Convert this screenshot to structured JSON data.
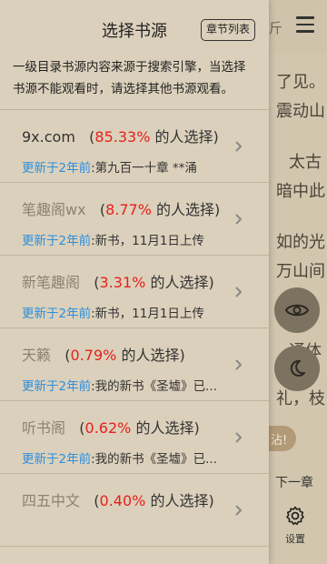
{
  "reader": {
    "top_fragment": "斤",
    "lines": [
      "了见。",
      "震动山",
      "太古",
      "暗中此",
      "如的光",
      "万山间",
      "兰",
      "通体",
      "礼，枝"
    ],
    "pill_text": "沾!",
    "next_chapter": "下一章",
    "settings_label": "设置"
  },
  "panel": {
    "title": "选择书源",
    "chapter_list_button": "章节列表",
    "notice": "一级目录书源内容来源于搜索引擎，当选择书源不能观看时，请选择其他书源观看。"
  },
  "sources": [
    {
      "name": "9x.com",
      "percent": "85.33%",
      "suffix": "的人选择)",
      "update_label": "更新于2年前",
      "update_text": ":第九百一十章 **涌"
    },
    {
      "name": "笔趣阁wx",
      "percent": "8.77%",
      "suffix": "的人选择)",
      "update_label": "更新于2年前",
      "update_text": ":新书，11月1日上传"
    },
    {
      "name": "新笔趣阁",
      "percent": "3.31%",
      "suffix": "的人选择)",
      "update_label": "更新于2年前",
      "update_text": ":新书，11月1日上传"
    },
    {
      "name": "天籁",
      "percent": "0.79%",
      "suffix": "的人选择)",
      "update_label": "更新于2年前",
      "update_text": ":我的新书《圣墟》已..."
    },
    {
      "name": "听书阁",
      "percent": "0.62%",
      "suffix": "的人选择)",
      "update_label": "更新于2年前",
      "update_text": ":我的新书《圣墟》已..."
    },
    {
      "name": "四五中文",
      "percent": "0.40%",
      "suffix": "的人选择)",
      "update_label": "",
      "update_text": ""
    }
  ],
  "colors": {
    "percent": "#e5211c",
    "update_label": "#2b8fe0",
    "panel_bg": "#dbd0bb"
  }
}
